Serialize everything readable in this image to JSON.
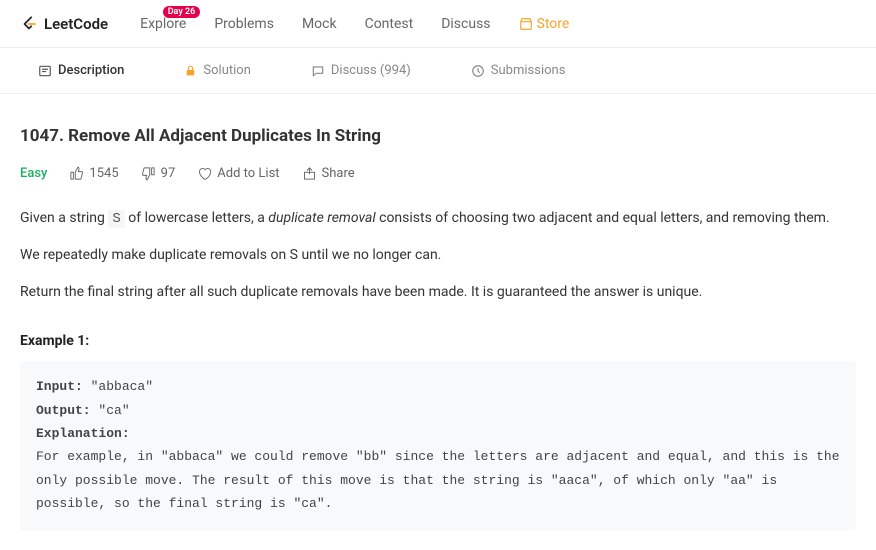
{
  "nav": {
    "brand": "LeetCode",
    "items": [
      "Explore",
      "Problems",
      "Mock",
      "Contest",
      "Discuss",
      "Store"
    ],
    "badge": "Day 26"
  },
  "tabs": {
    "description": "Description",
    "solution": "Solution",
    "discuss": "Discuss (994)",
    "submissions": "Submissions"
  },
  "problem": {
    "title": "1047. Remove All Adjacent Duplicates In String",
    "difficulty": "Easy",
    "likes": "1545",
    "dislikes": "97",
    "add": "Add to List",
    "share": "Share"
  },
  "desc": {
    "p1a": "Given a string ",
    "p1code": "S",
    "p1b": " of lowercase letters, a ",
    "p1em": "duplicate removal",
    "p1c": " consists of choosing two adjacent and equal letters, and removing them.",
    "p2": "We repeatedly make duplicate removals on S until we no longer can.",
    "p3": "Return the final string after all such duplicate removals have been made.  It is guaranteed the answer is unique."
  },
  "example": {
    "heading": "Example 1:",
    "input_label": "Input: ",
    "input_val": "\"abbaca\"",
    "output_label": "Output: ",
    "output_val": "\"ca\"",
    "expl_label": "Explanation: ",
    "expl_text": "For example, in \"abbaca\" we could remove \"bb\" since the letters are adjacent and equal, and this is the only possible move.  The result of this move is that the string is \"aaca\", of which only \"aa\" is possible, so the final string is \"ca\"."
  }
}
